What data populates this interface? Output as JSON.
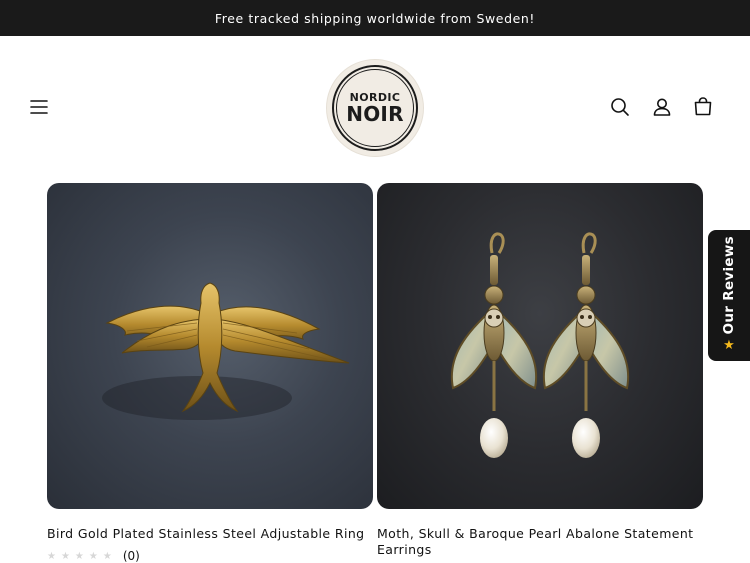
{
  "announcement": {
    "text": "Free tracked shipping worldwide from Sweden!"
  },
  "header": {
    "logo": {
      "line1": "NORDIC",
      "line2": "NOIR"
    },
    "icons": [
      "menu-icon",
      "search-icon",
      "account-icon",
      "cart-icon"
    ]
  },
  "products": [
    {
      "title": "Bird Gold Plated Stainless Steel Adjustable Ring",
      "rating_stars": "★★★★★",
      "rating_count": "(0)"
    },
    {
      "title": "Moth, Skull & Baroque Pearl Abalone Statement Earrings"
    }
  ],
  "reviews_tab": {
    "label": "Our Reviews",
    "icon": "★"
  },
  "colors": {
    "announcement_bg": "#1a1a1a",
    "text": "#121212",
    "star_empty": "#d7d7d7",
    "review_star": "#f5b91c"
  }
}
